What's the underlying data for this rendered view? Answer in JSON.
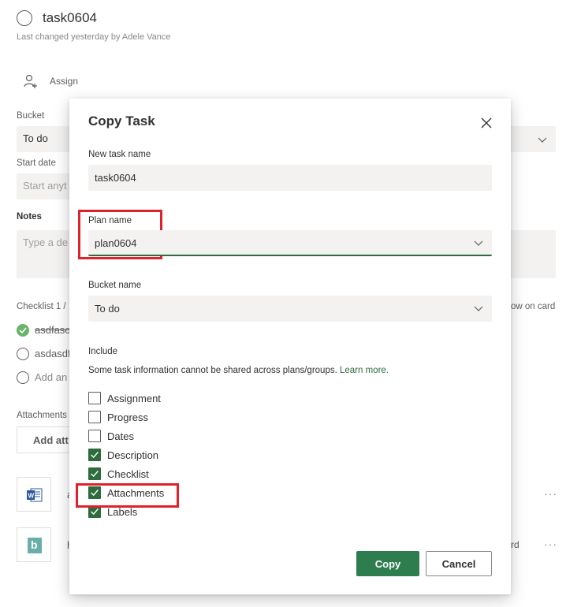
{
  "task": {
    "title": "task0604",
    "subtitle": "Last changed yesterday by Adele Vance",
    "assign_label": "Assign",
    "bucket_label": "Bucket",
    "bucket_value": "To do",
    "start_date_label": "Start date",
    "start_date_placeholder": "Start anyt",
    "notes_label": "Notes",
    "notes_placeholder": "Type a de",
    "checklist_label": "Checklist 1 /",
    "show_on_card": "ow on card",
    "checklist_items": [
      "asdfasc",
      "asdasdf"
    ],
    "add_item": "Add an",
    "attachments_label": "Attachments",
    "add_attachment": "Add att",
    "attachment_suffix_1": "a",
    "attachment_suffix_2": "h",
    "attachment_right_2": "rd",
    "more": "···"
  },
  "dialog": {
    "title": "Copy Task",
    "new_task_name_label": "New task name",
    "new_task_name_value": "task0604",
    "plan_name_label": "Plan name",
    "plan_name_value": "plan0604",
    "bucket_name_label": "Bucket name",
    "bucket_name_value": "To do",
    "include_label": "Include",
    "note_text": "Some task information cannot be shared across plans/groups.",
    "learn_more": "Learn more.",
    "options": [
      {
        "label": "Assignment",
        "checked": false
      },
      {
        "label": "Progress",
        "checked": false
      },
      {
        "label": "Dates",
        "checked": false
      },
      {
        "label": "Description",
        "checked": true
      },
      {
        "label": "Checklist",
        "checked": true
      },
      {
        "label": "Attachments",
        "checked": true
      },
      {
        "label": "Labels",
        "checked": true
      }
    ],
    "copy_button": "Copy",
    "cancel_button": "Cancel"
  },
  "colors": {
    "accent": "#2e7d4f",
    "highlight": "#e0202a"
  }
}
